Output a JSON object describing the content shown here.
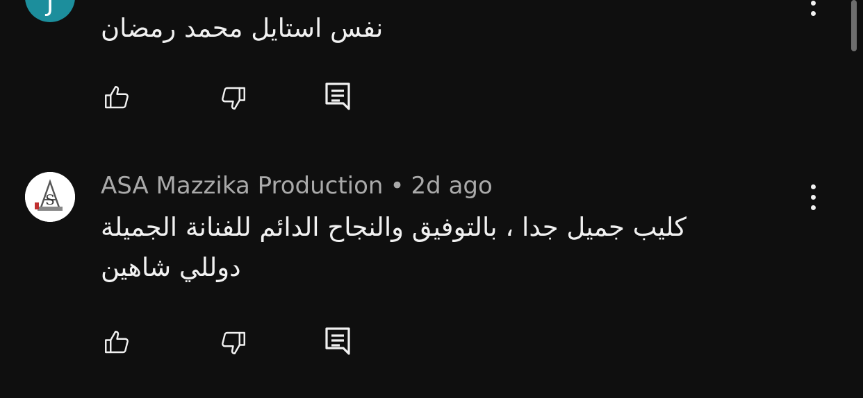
{
  "comments": [
    {
      "avatar_letter": "J",
      "avatar_color": "#1c8e9c",
      "text_lines": [
        "نفس استايل محمد رمضان"
      ],
      "actions": {
        "like_icon": "thumb-up-icon",
        "dislike_icon": "thumb-down-icon",
        "reply_icon": "reply-icon"
      }
    },
    {
      "author": "ASA Mazzika Production",
      "separator": "•",
      "time": "2d ago",
      "avatar_logo_text": "ASA",
      "text_lines": [
        "كليب جميل جدا ، بالتوفيق والنجاح الدائم للفنانة الجميلة",
        "دوللي شاهين"
      ],
      "actions": {
        "like_icon": "thumb-up-icon",
        "dislike_icon": "thumb-down-icon",
        "reply_icon": "reply-icon"
      }
    }
  ],
  "colors": {
    "background": "#0f0f0f",
    "primary_text": "#f1f1f1",
    "secondary_text": "#aaaaaa"
  }
}
